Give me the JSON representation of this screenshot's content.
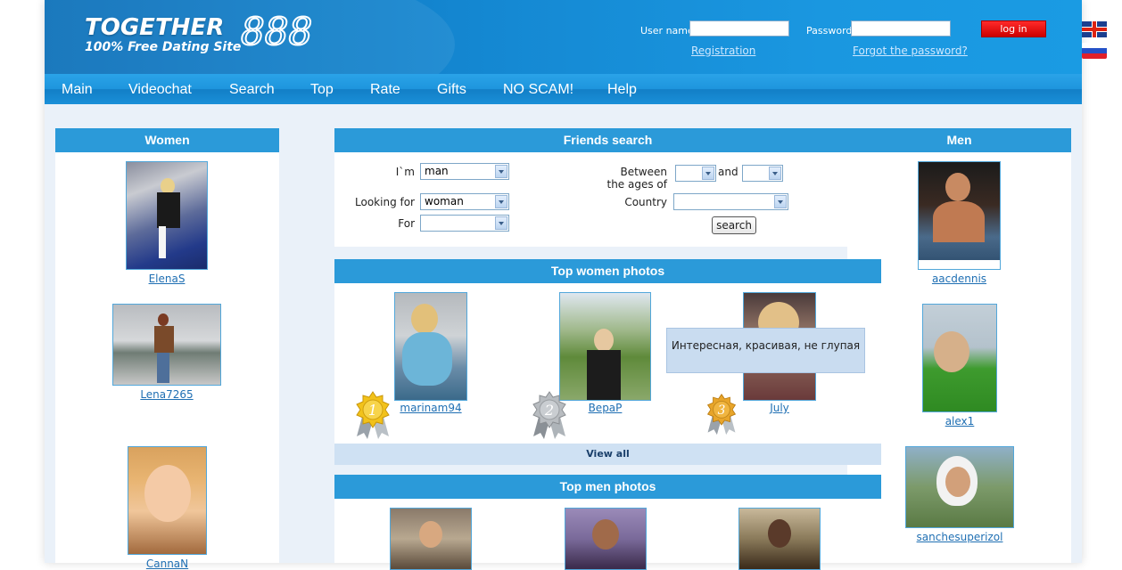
{
  "header": {
    "logo_word": "TOGETHER",
    "logo_number": "888",
    "logo_tagline": "100% Free Dating Site",
    "username_label": "User name",
    "password_label": "Password",
    "login_button": "log in",
    "registration_link": "Registration",
    "forgot_link": "Forgot the password?"
  },
  "nav": [
    "Main",
    "Videochat",
    "Search",
    "Top",
    "Rate",
    "Gifts",
    "NO SCAM!",
    "Help"
  ],
  "languages": [
    "uk-flag-icon",
    "russia-flag-icon"
  ],
  "women": {
    "title": "Women",
    "profiles": [
      "ElenaS",
      "Lena7265",
      "CannaN"
    ]
  },
  "men": {
    "title": "Men",
    "profiles": [
      "aacdennis",
      "alex1",
      "sanchesuperizol"
    ]
  },
  "friends_search": {
    "title": "Friends search",
    "im_label": "I`m",
    "im_value": "man",
    "looking_label": "Looking for",
    "looking_value": "woman",
    "for_label": "For",
    "for_value": "",
    "ages_label_1": "Between",
    "ages_label_2": "the ages of",
    "and_label": "and",
    "country_label": "Country",
    "search_button": "search"
  },
  "top_women": {
    "title": "Top women photos",
    "items": [
      {
        "name": "marinam94",
        "rank": "1"
      },
      {
        "name": "BepaP",
        "rank": "2"
      },
      {
        "name": "July",
        "rank": "3"
      }
    ],
    "view_all": "View all"
  },
  "top_men": {
    "title": "Top men photos"
  },
  "tooltip": "Интересная, красивая, не глупая",
  "colors": {
    "header_blue": "#1589d3",
    "section_head": "#2b9ad9",
    "login_red": "#e00000"
  }
}
